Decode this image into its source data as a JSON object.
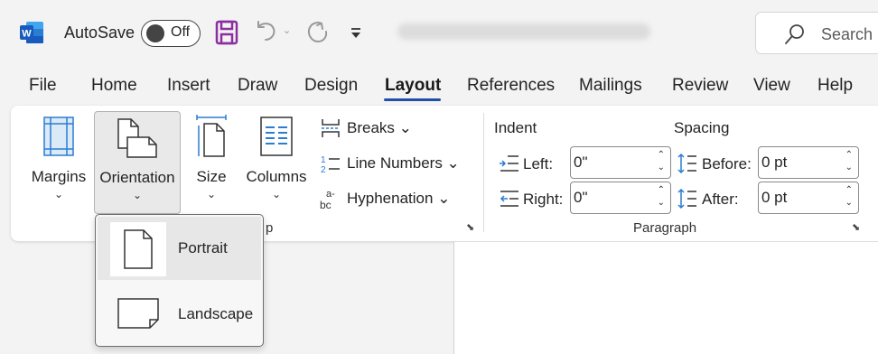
{
  "titlebar": {
    "autosave_label": "AutoSave",
    "autosave_state": "Off",
    "search_placeholder": "Search"
  },
  "tabs": [
    "File",
    "Home",
    "Insert",
    "Draw",
    "Design",
    "Layout",
    "References",
    "Mailings",
    "Review",
    "View",
    "Help"
  ],
  "active_tab": "Layout",
  "page_setup": {
    "margins_label": "Margins",
    "orientation_label": "Orientation",
    "size_label": "Size",
    "columns_label": "Columns",
    "breaks_label": "Breaks",
    "line_numbers_label": "Line Numbers",
    "hyphenation_label": "Hyphenation",
    "group_label_fragment": "p"
  },
  "paragraph": {
    "indent_heading": "Indent",
    "spacing_heading": "Spacing",
    "left_label": "Left:",
    "left_value": "0\"",
    "right_label": "Right:",
    "right_value": "0\"",
    "before_label": "Before:",
    "before_value": "0 pt",
    "after_label": "After:",
    "after_value": "0 pt",
    "group_label": "Paragraph"
  },
  "orientation_menu": {
    "portrait_label": "Portrait",
    "landscape_label": "Landscape",
    "selected": "Portrait"
  },
  "colors": {
    "accent": "#1f4fa6",
    "word_blue": "#185abd",
    "save_purple": "#8b2fa0",
    "icon_blue": "#2b7cd3"
  }
}
